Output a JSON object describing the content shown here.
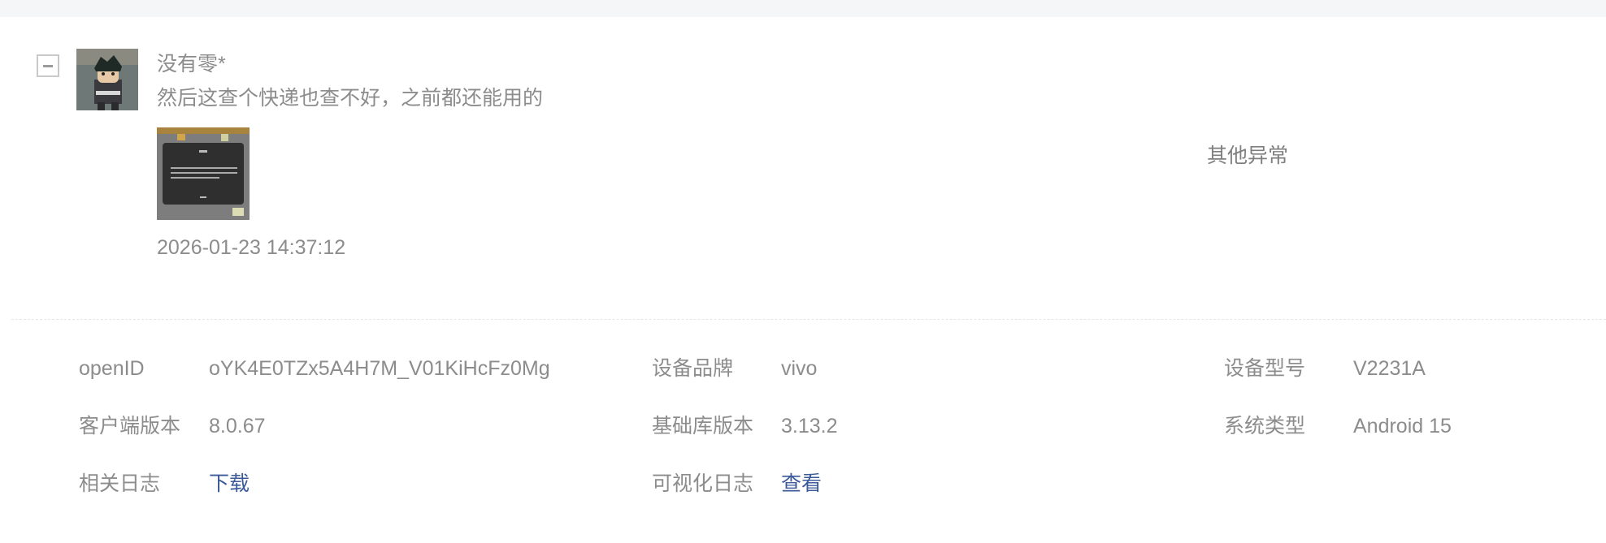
{
  "feedback": {
    "username": "没有零*",
    "message": "然后这查个快递也查不好，之前都还能用的",
    "timestamp": "2026-01-23 14:37:12",
    "category": "其他异常"
  },
  "info": {
    "openid": {
      "label": "openID",
      "value": "oYK4E0TZx5A4H7M_V01KiHcFz0Mg"
    },
    "device_brand": {
      "label": "设备品牌",
      "value": "vivo"
    },
    "device_model": {
      "label": "设备型号",
      "value": "V2231A"
    },
    "client_version": {
      "label": "客户端版本",
      "value": "8.0.67"
    },
    "lib_version": {
      "label": "基础库版本",
      "value": "3.13.2"
    },
    "os_type": {
      "label": "系统类型",
      "value": "Android 15"
    },
    "related_logs": {
      "label": "相关日志",
      "value": "下载"
    },
    "visual_logs": {
      "label": "可视化日志",
      "value": "查看"
    }
  },
  "colors": {
    "link": "#3c5a99",
    "text": "#8c8c8c",
    "top_strip": "#f5f6f8"
  }
}
